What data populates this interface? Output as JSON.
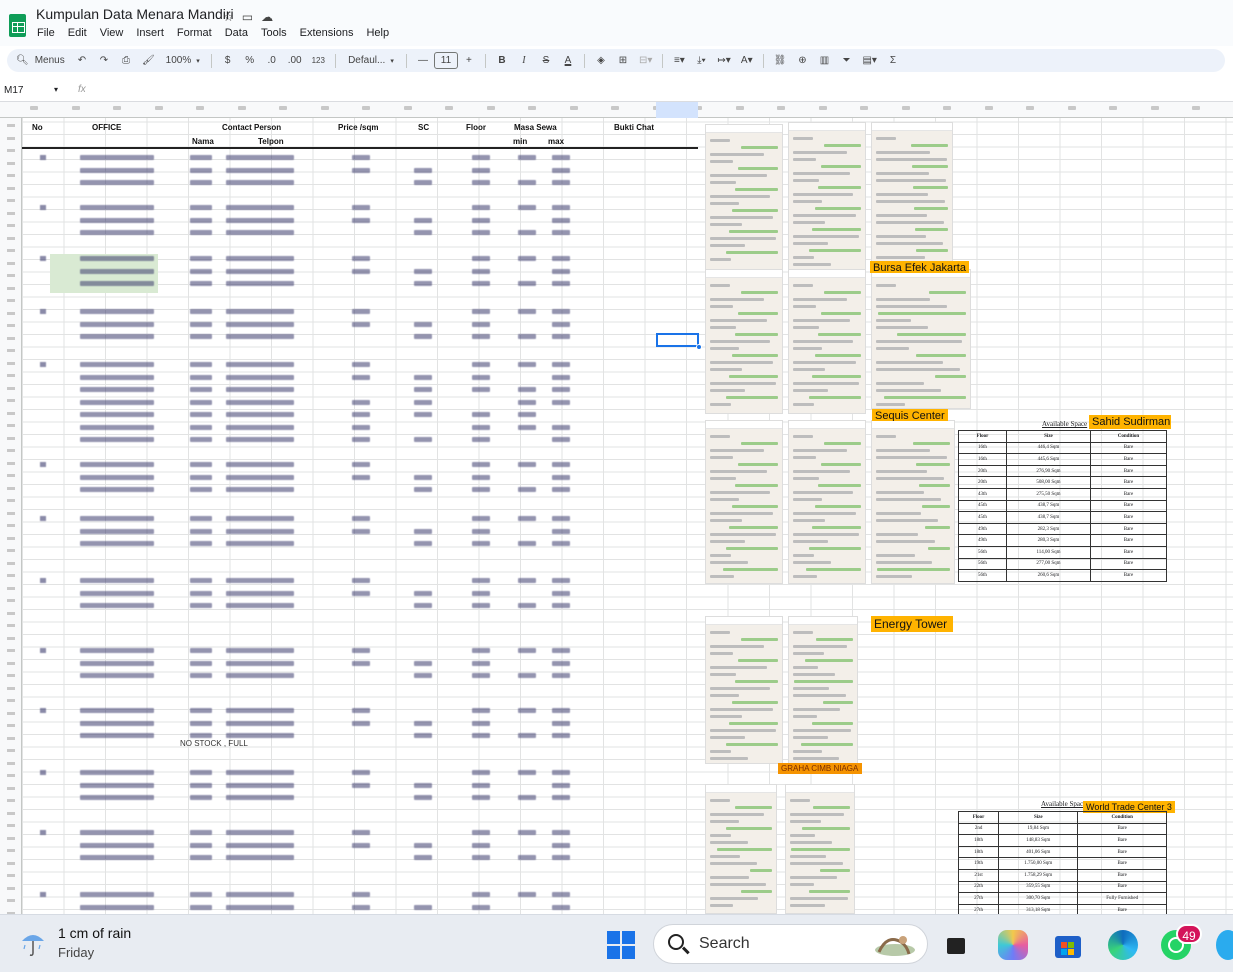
{
  "app": {
    "title": "Kumpulan Data Menara Mandiri",
    "menu": [
      "File",
      "Edit",
      "View",
      "Insert",
      "Format",
      "Data",
      "Tools",
      "Extensions",
      "Help"
    ]
  },
  "toolbar": {
    "search_menus": "Menus",
    "zoom": "100%",
    "currency": "$",
    "percent": "%",
    "decimal_decrease": ".0",
    "decimal_increase": ".00",
    "number_format": "123",
    "font": "Defaul...",
    "font_size": "11",
    "bold": "B",
    "italic": "I",
    "strike": "S",
    "text_color": "A",
    "sum": "Σ",
    "icons": [
      "search-icon",
      "undo-icon",
      "redo-icon",
      "print-icon",
      "paint-format-icon",
      "minus-icon",
      "plus-icon",
      "fill-color-icon",
      "borders-icon",
      "merge-icon",
      "align-icon",
      "valign-icon",
      "wrap-icon",
      "rotate-icon",
      "link-icon",
      "comment-icon",
      "chart-icon",
      "filter-icon",
      "views-icon"
    ]
  },
  "formula_bar": {
    "cell_ref": "M17",
    "fx": "fx"
  },
  "sheet": {
    "headers": {
      "no": "No",
      "office": "OFFICE",
      "contact": "Contact Person",
      "nama": "Nama",
      "telpon": "Telpon",
      "price": "Price /sqm",
      "sc": "SC",
      "floor": "Floor",
      "masa": "Masa Sewa",
      "min": "min",
      "max": "max",
      "bukti": "Bukti Chat"
    },
    "note_row": "NO STOCK , FULL"
  },
  "labels": {
    "bursa": "Bursa Efek Jakarta",
    "sequis": "Sequis Center",
    "sahid": "Sahid Sudirman",
    "energy": "Energy Tower",
    "graha": "GRAHA CIMB NIAGA",
    "wtc3": "World Trade Center 3",
    "available": "Available Space"
  },
  "sahid_table": {
    "columns": [
      "Floor",
      "Size",
      "Condition"
    ],
    "rows": [
      [
        "16th",
        "446,4 Sqm",
        "Bare"
      ],
      [
        "16th",
        "445,6 Sqm",
        "Bare"
      ],
      [
        "20th",
        "276,90 Sqm",
        "Bare"
      ],
      [
        "20th",
        "508,00 Sqm",
        "Bare"
      ],
      [
        "43th",
        "275,50 Sqm",
        "Bare"
      ],
      [
        "45th",
        "438,7 Sqm",
        "Bare"
      ],
      [
        "45th",
        "438,7 Sqm",
        "Bare"
      ],
      [
        "49th",
        "282,3 Sqm",
        "Bare"
      ],
      [
        "49th",
        "280,3 Sqm",
        "Bare"
      ],
      [
        "56th",
        "114,00 Sqm",
        "Bare"
      ],
      [
        "56th",
        "277,00 Sqm",
        "Bare"
      ],
      [
        "56th",
        "260,6 Sqm",
        "Bare"
      ]
    ]
  },
  "wtc_table": {
    "columns": [
      "Floor",
      "Size",
      "Condition"
    ],
    "rows": [
      [
        "2nd",
        "19,84 Sqm",
        "Bare"
      ],
      [
        "18th",
        "148,83 Sqm",
        "Bare"
      ],
      [
        "18th",
        "401,06 Sqm",
        "Bare"
      ],
      [
        "19th",
        "1.750,00 Sqm",
        "Bare"
      ],
      [
        "21st",
        "1.758,29 Sqm",
        "Bare"
      ],
      [
        "22th",
        "359,55 Sqm",
        "Bare"
      ],
      [
        "27th",
        "300,70 Sqm",
        "Fully Furnished"
      ],
      [
        "27th",
        "313,18 Sqm",
        "Bare"
      ]
    ]
  },
  "taskbar": {
    "weather_temp": "1 cm of rain",
    "weather_day": "Friday",
    "search": "Search",
    "whatsapp_badge": "49",
    "colors": {
      "accent": "#1a73e8",
      "sheets_green": "#0f9d58",
      "label_orange": "#ffb300"
    }
  }
}
